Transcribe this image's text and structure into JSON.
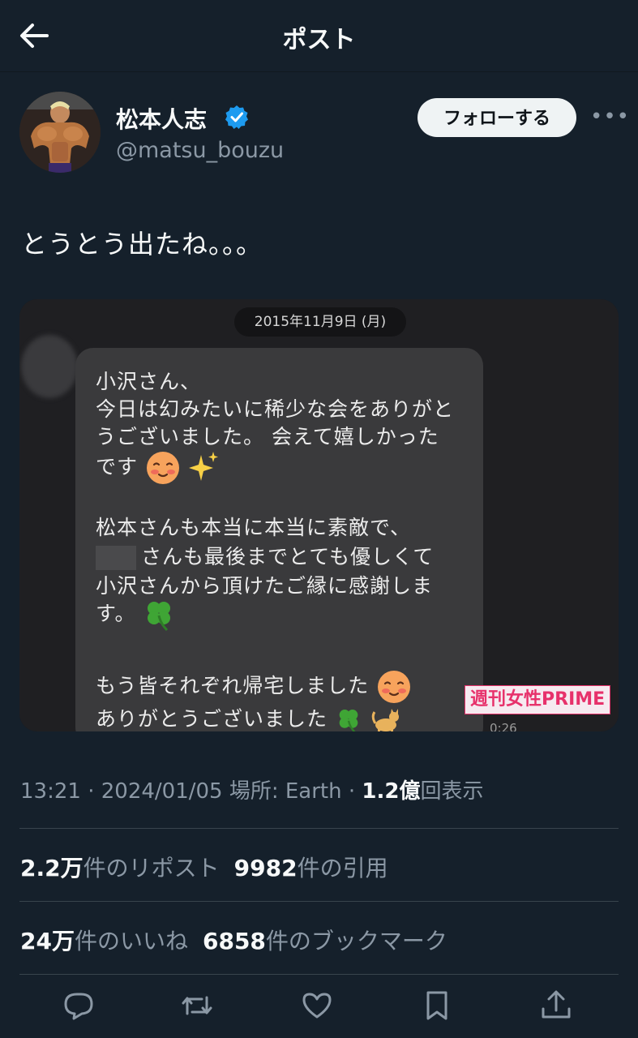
{
  "header": {
    "title": "ポスト"
  },
  "user": {
    "display_name": "松本人志",
    "handle": "@matsu_bouzu",
    "follow_label": "フォローする",
    "more_label": "•••"
  },
  "tweet": {
    "text": "とうとう出たね。。。"
  },
  "media": {
    "date": "2015年11月9日 (月)",
    "lines": [
      "小沢さん、",
      "今日は幻みたいに稀少な会をありがと",
      "うございました。 会えて嬉しかった",
      "です",
      "松本さんも本当に本当に素敵で、",
      "さんも最後までとても優しくて",
      "小沢さんから頂けたご縁に感謝しま",
      "す。",
      "もう皆それぞれ帰宅しました",
      "ありがとうございました"
    ],
    "watermark": "週刊女性PRIME",
    "time": "0:26"
  },
  "meta": {
    "time": "13:21",
    "date": "2024/01/05",
    "location": "場所: Earth",
    "views_num": "1.2億",
    "views_label": "回表示"
  },
  "stats": {
    "reposts_num": "2.2万",
    "reposts_label": "件のリポスト",
    "quotes_num": "9982",
    "quotes_label": "件の引用",
    "likes_num": "24万",
    "likes_label": "件のいいね",
    "bookmarks_num": "6858",
    "bookmarks_label": "件のブックマーク"
  },
  "colors": {
    "background": "#15202b",
    "text": "#e7e9ea",
    "secondary": "#8b98a5",
    "verified": "#1d9bf0",
    "follow_button": "#eff3f4"
  }
}
